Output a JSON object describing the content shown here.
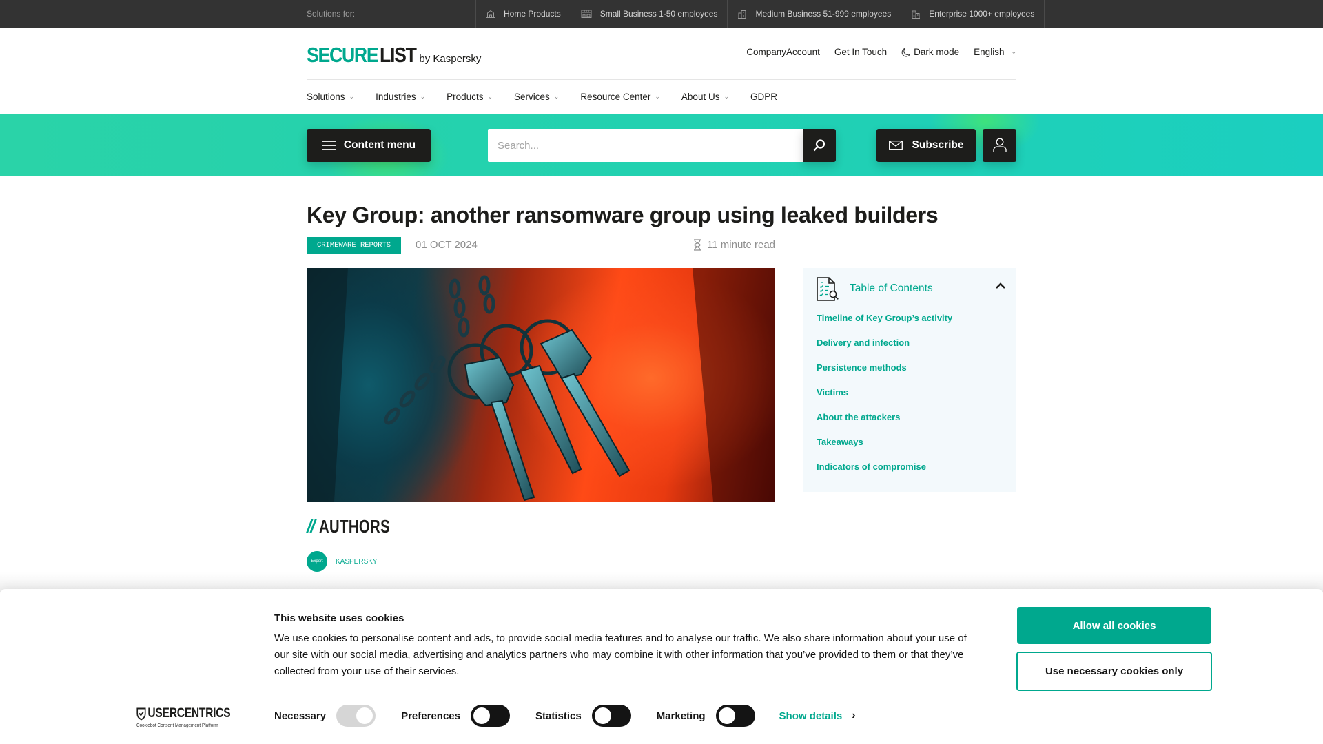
{
  "topbar": {
    "solutions_label": "Solutions for:",
    "segments": [
      {
        "label": "Home Products",
        "icon": "home-icon"
      },
      {
        "label": "Small Business 1-50 employees",
        "icon": "store-icon"
      },
      {
        "label": "Medium Business 51-999 employees",
        "icon": "office-building-icon"
      },
      {
        "label": "Enterprise 1000+ employees",
        "icon": "enterprise-building-icon"
      }
    ]
  },
  "header": {
    "logo_secure": "SECURE",
    "logo_list": "LIST",
    "logo_by": "by Kaspersky",
    "links": {
      "company_account": "CompanyAccount",
      "get_in_touch": "Get In Touch",
      "dark_mode": "Dark mode",
      "language": "English"
    }
  },
  "nav": {
    "items": [
      {
        "label": "Solutions",
        "dropdown": true
      },
      {
        "label": "Industries",
        "dropdown": true
      },
      {
        "label": "Products",
        "dropdown": true
      },
      {
        "label": "Services",
        "dropdown": true
      },
      {
        "label": "Resource Center",
        "dropdown": true
      },
      {
        "label": "About Us",
        "dropdown": true
      },
      {
        "label": "GDPR",
        "dropdown": false
      }
    ]
  },
  "band": {
    "content_menu_label": "Content menu",
    "search_placeholder": "Search...",
    "search_value": "",
    "subscribe_label": "Subscribe"
  },
  "article": {
    "title": "Key Group: another ransomware group using leaked builders",
    "category": "CRIMEWARE REPORTS",
    "date": "01 OCT 2024",
    "read_time": "11 minute read",
    "hero_alt": "Keys hanging on chains against a red and teal background"
  },
  "toc": {
    "title": "Table of Contents",
    "expanded": true,
    "items": [
      "Timeline of Key Group’s activity",
      "Delivery and infection",
      "Persistence methods",
      "Victims",
      "About the attackers",
      "Takeaways",
      "Indicators of compromise"
    ]
  },
  "authors": {
    "slashes": "//",
    "heading": "AUTHORS",
    "list": [
      {
        "badge": "Expert",
        "name": "KASPERSKY"
      }
    ]
  },
  "cookie": {
    "title": "This website uses cookies",
    "text": "We use cookies to personalise content and ads, to provide social media features and to analyse our traffic. We also share information about your use of our site with our social media, advertising and analytics partners who may combine it with other information that you’ve provided to them or that they’ve collected from your use of their services.",
    "logo_main": "USERCENTRICS",
    "logo_sub": "Cookiebot Consent Management Platform",
    "toggles": [
      {
        "label": "Necessary",
        "state": "on-disabled"
      },
      {
        "label": "Preferences",
        "state": "off"
      },
      {
        "label": "Statistics",
        "state": "off"
      },
      {
        "label": "Marketing",
        "state": "off"
      }
    ],
    "show_details": "Show details",
    "allow_all": "Allow all cookies",
    "necessary_only": "Use necessary cookies only"
  },
  "colors": {
    "brand": "#00a88e",
    "topbar": "#333333",
    "dark_button": "#1d1d1b",
    "band_start": "#2ad3a8",
    "band_end": "#1bcfc0",
    "toc_bg": "#f3f9fc"
  }
}
